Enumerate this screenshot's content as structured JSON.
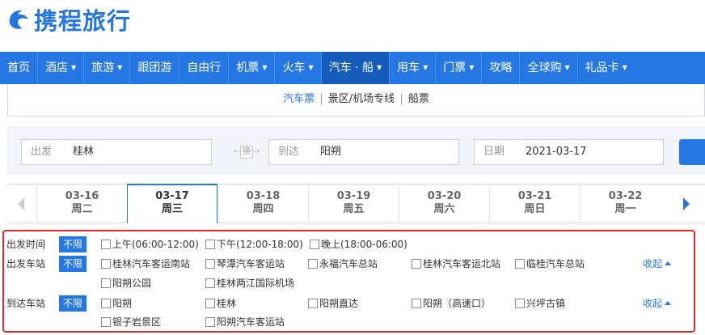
{
  "brand": {
    "name": "携程旅行",
    "color": "#2577e3",
    "icon": "dolphin-logo-icon"
  },
  "nav": [
    {
      "label": "首页",
      "caret": ""
    },
    {
      "label": "酒店",
      "caret": "▼"
    },
    {
      "label": "旅游",
      "caret": "▼"
    },
    {
      "label": "跟团游",
      "caret": ""
    },
    {
      "label": "自由行",
      "caret": ""
    },
    {
      "label": "机票",
      "caret": "▼"
    },
    {
      "label": "火车",
      "caret": "▼"
    },
    {
      "label": "汽车 · 船",
      "caret": "▼",
      "active": true
    },
    {
      "label": "用车",
      "caret": "▼"
    },
    {
      "label": "门票",
      "caret": "▼"
    },
    {
      "label": "攻略",
      "caret": ""
    },
    {
      "label": "全球购",
      "caret": "▼"
    },
    {
      "label": "礼品卡",
      "caret": "▼"
    }
  ],
  "subnav": {
    "bus": "汽车票",
    "scenic": "景区/机场专线",
    "boat": "船票",
    "sep": "|"
  },
  "search": {
    "from_label": "出发",
    "from_value": "桂林",
    "swap_label": "换",
    "to_label": "到达",
    "to_value": "阳朔",
    "date_label": "日期",
    "date_value": "2021-03-17"
  },
  "dates": [
    {
      "date": "03-16",
      "weekday": "周二"
    },
    {
      "date": "03-17",
      "weekday": "周三",
      "selected": true
    },
    {
      "date": "03-18",
      "weekday": "周四"
    },
    {
      "date": "03-19",
      "weekday": "周五"
    },
    {
      "date": "03-20",
      "weekday": "周六"
    },
    {
      "date": "03-21",
      "weekday": "周日"
    },
    {
      "date": "03-22",
      "weekday": "周一"
    }
  ],
  "filters": {
    "unlimited": "不限",
    "collapse": "收起",
    "depart_time": {
      "label": "出发时间",
      "options": [
        "上午(06:00-12:00)",
        "下午(12:00-18:00)",
        "晚上(18:00-06:00)"
      ]
    },
    "depart_station": {
      "label": "出发车站",
      "options": [
        "桂林汽车客运南站",
        "琴潭汽车客运站",
        "永福汽车总站",
        "桂林汽车客运北站",
        "临桂汽车总站",
        "阳朔公园",
        "桂林两江国际机场"
      ]
    },
    "arrive_station": {
      "label": "到达车站",
      "options": [
        "阳朔",
        "桂林",
        "阳朔直达",
        "阳朔（高速口）",
        "兴坪古镇",
        "银子岩景区",
        "阳朔汽车客运站"
      ]
    }
  }
}
